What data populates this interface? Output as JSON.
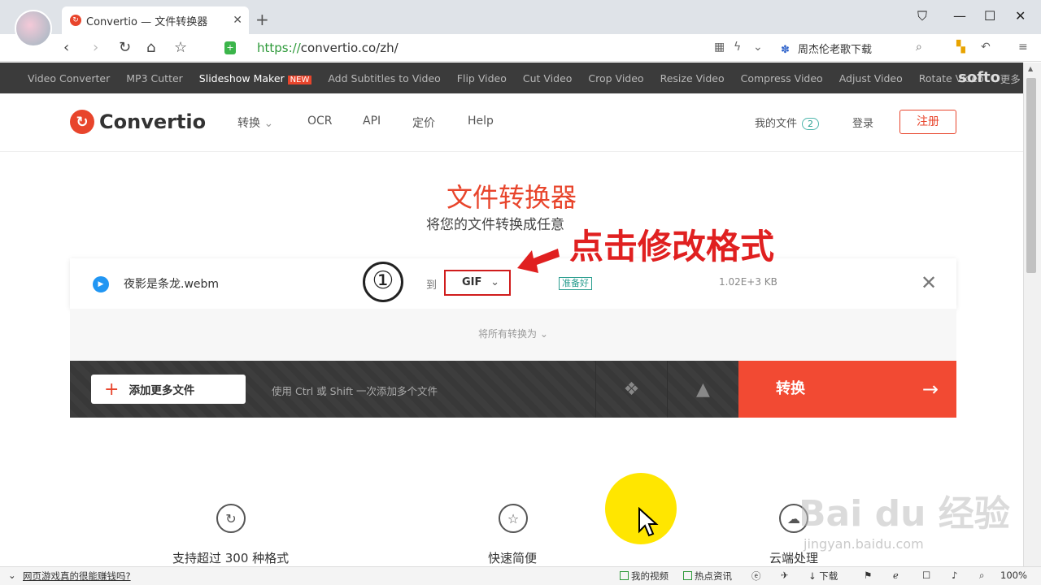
{
  "browser": {
    "tab_title": "Convertio — 文件转换器",
    "url_scheme": "https://",
    "url_rest": "convertio.co/zh/",
    "search_text": "周杰伦老歌下载"
  },
  "toolbar": {
    "items": [
      "Video Converter",
      "MP3 Cutter",
      "Slideshow Maker",
      "Add Subtitles to Video",
      "Flip Video",
      "Cut Video",
      "Crop Video",
      "Resize Video",
      "Compress Video",
      "Adjust Video",
      "Rotate Video",
      "更多"
    ],
    "new_badge": "NEW",
    "brand": "softo"
  },
  "header": {
    "logo_text": "Convertio",
    "menu": [
      "转换",
      "OCR",
      "API",
      "定价",
      "Help"
    ],
    "my_files": "我的文件",
    "files_count": "2",
    "login": "登录",
    "register": "注册"
  },
  "hero": {
    "title": "文件转换器",
    "subtitle": "将您的文件转换成任意",
    "callout": "点击修改格式",
    "step": "①"
  },
  "converter": {
    "file_name": "夜影是条龙.webm",
    "to_label": "到",
    "format": "GIF",
    "status": "准备好",
    "file_size": "1.02E+3 KB",
    "convert_all": "将所有转换为",
    "add_files": "添加更多文件",
    "hint": "使用 Ctrl 或 Shift 一次添加多个文件",
    "convert_button": "转换"
  },
  "features": [
    "支持超过 300 种格式",
    "快速简便",
    "云端处理"
  ],
  "watermark": {
    "main": "Bai du 经验",
    "sub": "jingyan.baidu.com"
  },
  "statusbar": {
    "news": "网页游戏真的很能赚钱吗?",
    "my_video": "我的视频",
    "hot_news": "热点资讯",
    "download": "下载",
    "zoom": "100%"
  },
  "colors": {
    "accent": "#e8452c",
    "convert": "#f24a33",
    "highlight": "#ffe600",
    "annotation": "#e02020"
  }
}
